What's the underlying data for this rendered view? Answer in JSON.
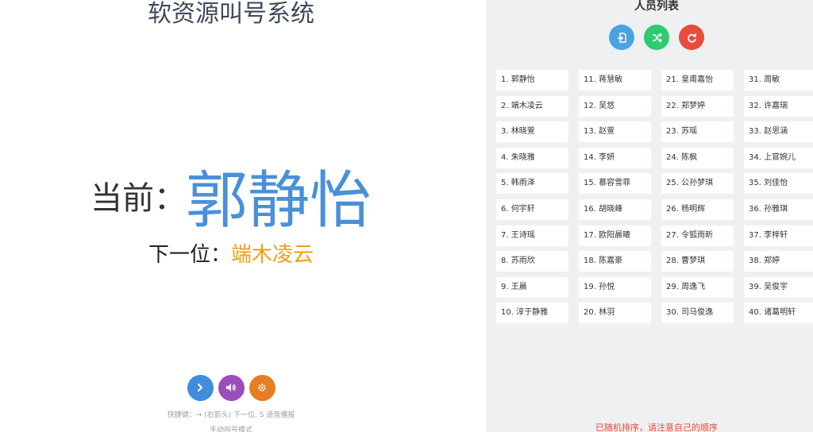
{
  "app": {
    "title": "软资源叫号系统"
  },
  "display": {
    "current_label": "当前：",
    "current_name": "郭静怡",
    "next_label": "下一位：",
    "next_name": "端木凌云"
  },
  "controls": {
    "next_icon": "chevron-right-icon",
    "speak_icon": "volume-icon",
    "settings_icon": "gear-icon",
    "hint": "快捷键：→ (右箭头) 下一位, S 语音播报",
    "mode": "手动叫号模式"
  },
  "panel": {
    "title": "人员列表",
    "actions": [
      {
        "name": "import-icon",
        "color": "#4aa3df"
      },
      {
        "name": "shuffle-icon",
        "color": "#2ecc71"
      },
      {
        "name": "reset-icon",
        "color": "#e74c3c"
      }
    ],
    "people": [
      "1. 郭静怡",
      "2. 端木凌云",
      "3. 林晓萱",
      "4. 朱晓雅",
      "5. 韩雨泽",
      "6. 何宇轩",
      "7. 王诗瑶",
      "8. 苏雨欣",
      "9. 王晨",
      "10. 淳于静雅",
      "11. 蒋慧敏",
      "12. 吴悠",
      "13. 赵萱",
      "14. 李妍",
      "15. 慕容雪菲",
      "16. 胡晓峰",
      "17. 欧阳晨曦",
      "18. 陈嘉豪",
      "19. 孙悦",
      "20. 林羽",
      "21. 皇甫嘉怡",
      "22. 郑梦婷",
      "23. 苏瑶",
      "24. 陈枫",
      "25. 公孙梦琪",
      "26. 杨明辉",
      "27. 令狐雨昕",
      "28. 曹梦琪",
      "29. 周逸飞",
      "30. 司马俊逸",
      "31. 周敏",
      "32. 许嘉瑞",
      "33. 赵思涵",
      "34. 上官婉儿",
      "35. 刘佳怡",
      "36. 孙雅琪",
      "37. 李梓轩",
      "38. 郑婷",
      "39. 吴俊宇",
      "40. 诸葛明轩"
    ],
    "notice": "已随机排序，请注意自己的顺序"
  },
  "colors": {
    "accent_blue": "#4a90d9",
    "next_orange": "#f39c12",
    "notice_red": "#e74c3c"
  }
}
